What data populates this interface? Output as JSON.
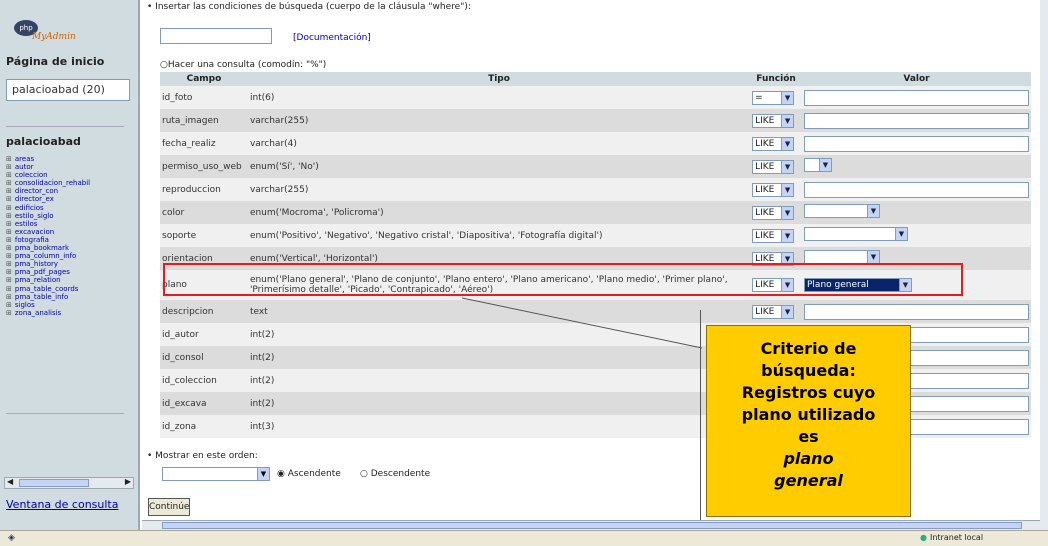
{
  "sidebar": {
    "logo_text": "php",
    "logo_name": "MyAdmin",
    "home_label": "Página de inicio",
    "db_selector_value": "palacioabad (20)",
    "db_name": "palacioabad",
    "tables": [
      "areas",
      "autor",
      "coleccion",
      "consolidacion_rehabil",
      "director_con",
      "director_ex",
      "edificios",
      "estilo_siglo",
      "estilos",
      "excavacion",
      "fotografia",
      "pma_bookmark",
      "pma_column_info",
      "pma_history",
      "pma_pdf_pages",
      "pma_relation",
      "pma_table_coords",
      "pma_table_info",
      "siglos",
      "zona_analisis"
    ],
    "query_window_link": "Ventana de consulta"
  },
  "main": {
    "where_label": "Insertar las condiciones de búsqueda (cuerpo de la cláusula \"where\"):",
    "documentation_link": "[Documentación]",
    "query_mode_label": "Hacer una consulta (comodín: \"%\")",
    "columns": [
      "Campo",
      "Tipo",
      "Función",
      "Valor"
    ],
    "rows": [
      {
        "campo": "id_foto",
        "tipo": "int(6)",
        "funcion": "=",
        "valor_type": "input"
      },
      {
        "campo": "ruta_imagen",
        "tipo": "varchar(255)",
        "funcion": "LIKE",
        "valor_type": "input"
      },
      {
        "campo": "fecha_realiz",
        "tipo": "varchar(4)",
        "funcion": "LIKE",
        "valor_type": "input"
      },
      {
        "campo": "permiso_uso_web",
        "tipo": "enum('Sí', 'No')",
        "funcion": "LIKE",
        "valor_type": "select-small"
      },
      {
        "campo": "reproduccion",
        "tipo": "varchar(255)",
        "funcion": "LIKE",
        "valor_type": "input"
      },
      {
        "campo": "color",
        "tipo": "enum('Mocroma', 'Policroma')",
        "funcion": "LIKE",
        "valor_type": "select-mid"
      },
      {
        "campo": "soporte",
        "tipo": "enum('Positivo', 'Negativo', 'Negativo cristal', 'Diapositiva', 'Fotografía digital')",
        "funcion": "LIKE",
        "valor_type": "select-wide"
      },
      {
        "campo": "orientacion",
        "tipo": "enum('Vertical', 'Horizontal')",
        "funcion": "LIKE",
        "valor_type": "select-mid"
      },
      {
        "campo": "plano",
        "tipo": "enum('Plano general', 'Plano de conjunto', 'Plano entero', 'Plano americano', 'Plano medio', 'Primer plano', 'Primerísimo detalle', 'Picado', 'Contrapicado', 'Aéreo')",
        "funcion": "LIKE",
        "valor_type": "select-selected",
        "valor": "Plano general"
      },
      {
        "campo": "descripcion",
        "tipo": "text",
        "funcion": "LIKE",
        "valor_type": "input"
      },
      {
        "campo": "id_autor",
        "tipo": "int(2)",
        "funcion": "",
        "valor_type": "input"
      },
      {
        "campo": "id_consol",
        "tipo": "int(2)",
        "funcion": "",
        "valor_type": "input"
      },
      {
        "campo": "id_coleccion",
        "tipo": "int(2)",
        "funcion": "",
        "valor_type": "input"
      },
      {
        "campo": "id_excava",
        "tipo": "int(2)",
        "funcion": "",
        "valor_type": "input"
      },
      {
        "campo": "id_zona",
        "tipo": "int(3)",
        "funcion": "",
        "valor_type": "input"
      }
    ],
    "order_label": "Mostrar en este orden:",
    "ascending_label": "Ascendente",
    "descending_label": "Descendente",
    "continue_button": "Continúe"
  },
  "callout": {
    "line1": "Criterio de",
    "line2": "búsqueda:",
    "line3": "Registros cuyo",
    "line4": "plano utilizado",
    "line5": "es",
    "line6": "plano",
    "line7": "general"
  },
  "statusbar": {
    "zone": "Intranet local"
  },
  "colors": {
    "sidebar_bg": "#d0dce0",
    "row_light": "#f0f0f0",
    "row_dark": "#dcdcdc",
    "highlight_border": "#e02020",
    "callout_bg": "#ffcc00",
    "selected_option_bg": "#0a246a"
  }
}
